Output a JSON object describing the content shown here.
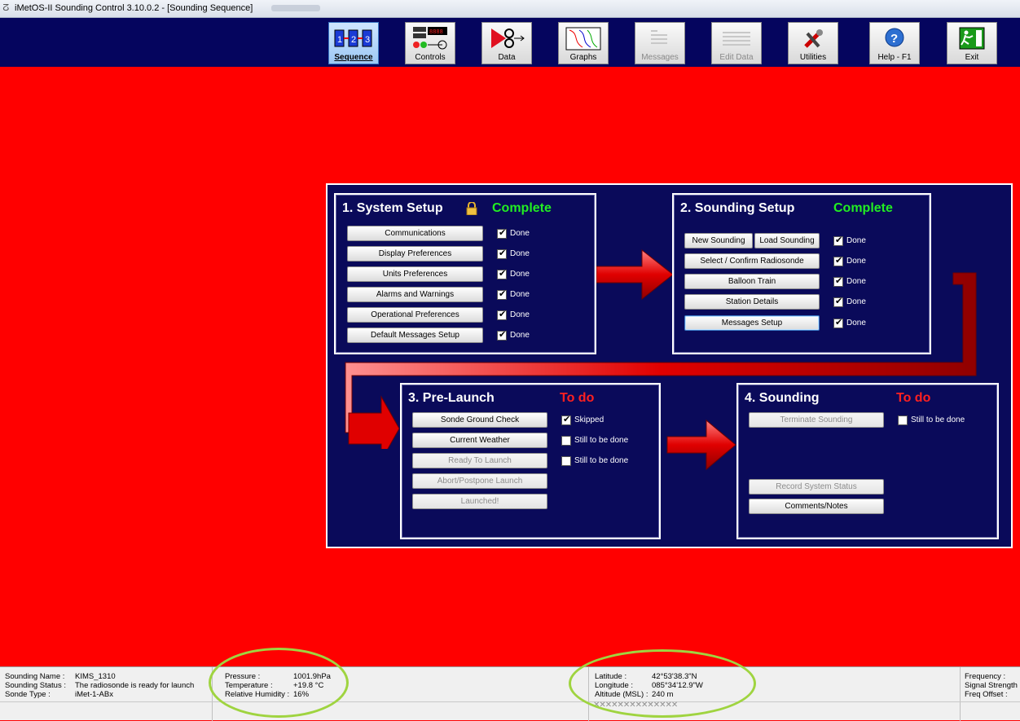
{
  "window": {
    "title": "iMetOS-II Sounding Control 3.10.0.2 - [Sounding Sequence]"
  },
  "toolbar": {
    "items": [
      {
        "label": "Sequence",
        "icon": "sequence-icon",
        "state": "active"
      },
      {
        "label": "Controls",
        "icon": "controls-icon",
        "state": "normal"
      },
      {
        "label": "Data",
        "icon": "data-icon",
        "state": "normal"
      },
      {
        "label": "Graphs",
        "icon": "graphs-icon",
        "state": "normal"
      },
      {
        "label": "Messages",
        "icon": "messages-icon",
        "state": "disabled"
      },
      {
        "label": "Edit Data",
        "icon": "edit-data-icon",
        "state": "disabled"
      },
      {
        "label": "Utilities",
        "icon": "utilities-icon",
        "state": "normal"
      },
      {
        "label": "Help - F1",
        "icon": "help-icon",
        "state": "normal"
      },
      {
        "label": "Exit",
        "icon": "exit-icon",
        "state": "normal"
      }
    ]
  },
  "panels": {
    "system_setup": {
      "title": "1. System Setup",
      "status": "Complete",
      "buttons": [
        "Communications",
        "Display Preferences",
        "Units Preferences",
        "Alarms and Warnings",
        "Operational Preferences",
        "Default Messages Setup"
      ],
      "checks": [
        "Done",
        "Done",
        "Done",
        "Done",
        "Done",
        "Done"
      ]
    },
    "sounding_setup": {
      "title": "2. Sounding Setup",
      "status": "Complete",
      "new_sounding": "New Sounding",
      "load_sounding": "Load Sounding",
      "buttons": [
        "Select / Confirm Radiosonde",
        "Balloon Train",
        "Station Details",
        "Messages Setup"
      ],
      "checks": [
        "Done",
        "Done",
        "Done",
        "Done",
        "Done"
      ]
    },
    "pre_launch": {
      "title": "3. Pre-Launch",
      "status": "To do",
      "buttons": [
        "Sonde Ground Check",
        "Current Weather",
        "Ready To Launch",
        "Abort/Postpone Launch",
        "Launched!"
      ],
      "checks": [
        "Skipped",
        "Still to be done",
        "Still to be done"
      ]
    },
    "sounding": {
      "title": "4. Sounding",
      "status": "To do",
      "terminate": "Terminate Sounding",
      "record": "Record System Status",
      "comments": "Comments/Notes",
      "check": "Still to be done"
    }
  },
  "statusbar": {
    "sounding_name_label": "Sounding Name :",
    "sounding_name": "KIMS_1310",
    "sounding_status_label": "Sounding Status :",
    "sounding_status": "The radiosonde is ready for launch",
    "sonde_type_label": "Sonde Type :",
    "sonde_type": "iMet-1-ABx",
    "pressure_label": "Pressure :",
    "pressure": "1001.9hPa",
    "temperature_label": "Temperature :",
    "temperature": "+19.8 °C",
    "humidity_label": "Relative Humidity :",
    "humidity": "16%",
    "latitude_label": "Latitude :",
    "latitude": "42°53'38.3\"N",
    "longitude_label": "Longitude :",
    "longitude": "085°34'12.9\"W",
    "altitude_label": "Altitude (MSL) :",
    "altitude": "240 m",
    "frequency_label": "Frequency :",
    "signal_label": "Signal Strength :",
    "freq_offset_label": "Freq Offset :"
  },
  "colors": {
    "background": "#ff0000",
    "canvas": "#0a0a5a",
    "complete": "#22ee22",
    "todo": "#ff2020",
    "highlight": "#9fd440"
  }
}
